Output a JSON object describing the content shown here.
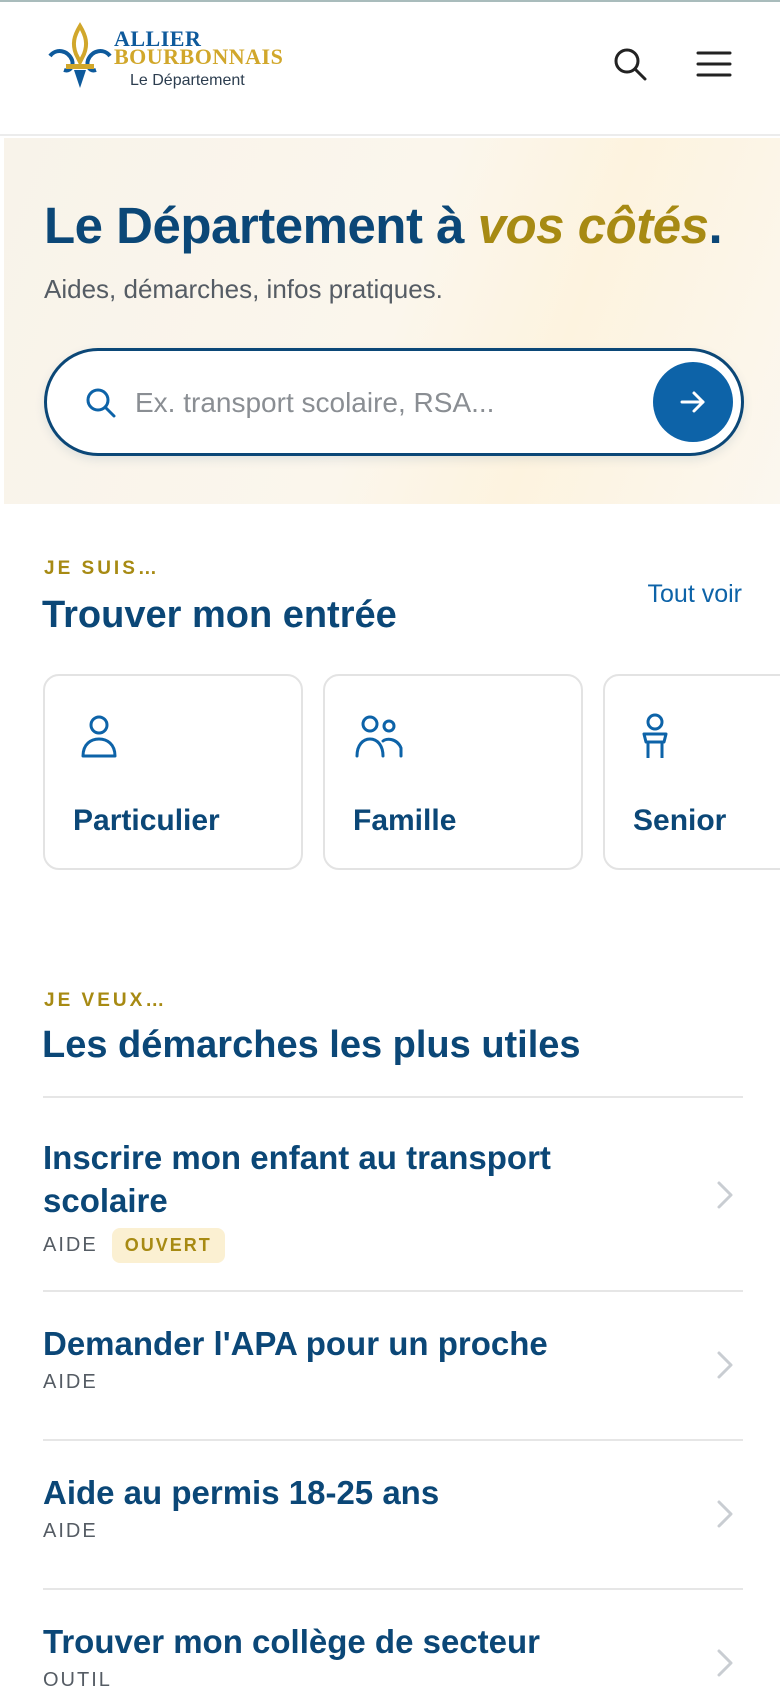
{
  "header": {
    "logo_line1": "ALLIER",
    "logo_line2": "BOURBONNAIS",
    "logo_line3": "Le Département",
    "search_icon": "search-icon",
    "menu_icon": "hamburger-menu-icon"
  },
  "hero": {
    "title_main": "Le Département à ",
    "title_accent": "vos côtés",
    "title_end": ".",
    "subtitle": "Aides, démarches, infos pratiques.",
    "search_placeholder": "Ex. transport scolaire, RSA...",
    "submit_icon": "arrow-right-icon"
  },
  "profiles": {
    "eyebrow": "JE SUIS…",
    "title": "Trouver mon entrée",
    "see_all": "Tout voir",
    "cards": [
      {
        "label": "Particulier",
        "icon": "person-icon"
      },
      {
        "label": "Famille",
        "icon": "family-icon"
      },
      {
        "label": "Senior",
        "icon": "senior-icon"
      }
    ]
  },
  "procedures": {
    "eyebrow": "JE VEUX…",
    "title": "Les démarches les plus utiles",
    "items": [
      {
        "title": "Inscrire mon enfant au transport scolaire",
        "type": "AIDE",
        "badge": "OUVERT"
      },
      {
        "title": "Demander l'APA pour un proche",
        "type": "AIDE"
      },
      {
        "title": "Aide au permis 18-25 ans",
        "type": "AIDE"
      },
      {
        "title": "Trouver mon collège de secteur",
        "type": "OUTIL"
      }
    ]
  },
  "colors": {
    "primary": "#0b4777",
    "accent_gold": "#a78a13",
    "button_blue": "#0d63a8",
    "badge_bg": "#fbf0d2"
  }
}
